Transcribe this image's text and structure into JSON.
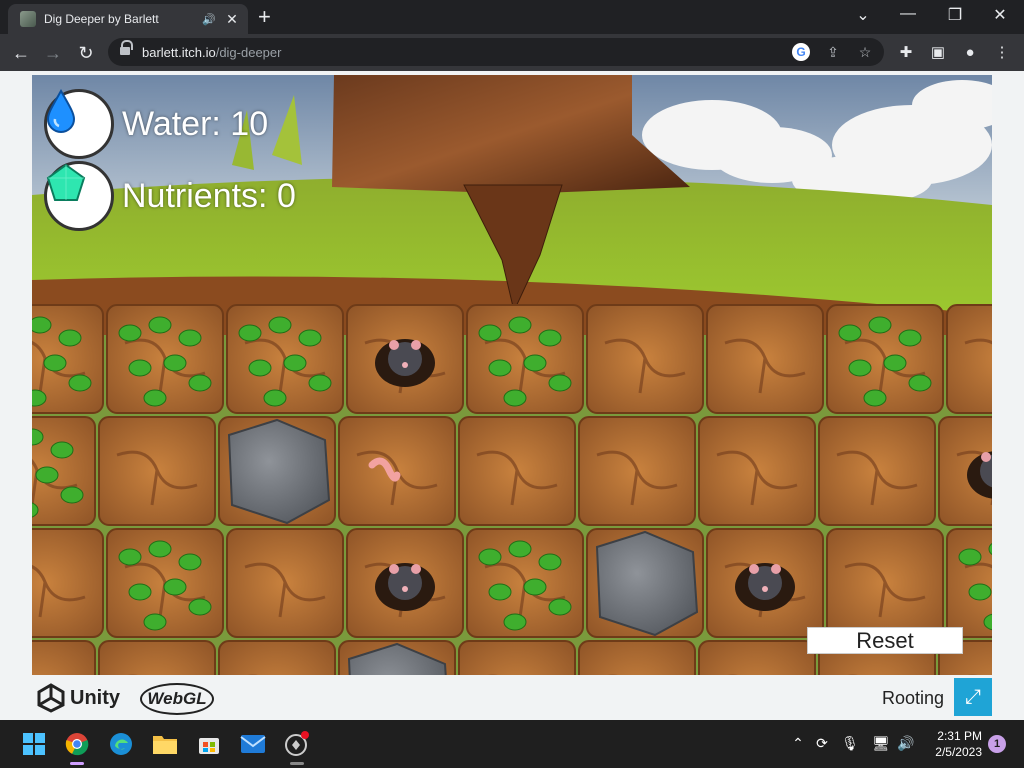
{
  "browser": {
    "tab_title": "Dig Deeper by Barlett",
    "new_tab": "+",
    "url_host": "barlett.itch.io",
    "url_path": "/dig-deeper"
  },
  "game": {
    "hud": {
      "water_label": "Water: 10",
      "nutrients_label": "Nutrients: 0",
      "water": 10,
      "nutrients": 0
    },
    "reset_label": "Reset",
    "grid": [
      [
        "leaf",
        "leaf",
        "leaf",
        "mole",
        "leaf",
        "dirt",
        "dirt",
        "leaf",
        "dirt"
      ],
      [
        "leaf",
        "dirt",
        "rock",
        "worm",
        "dirt",
        "dirt",
        "dirt",
        "dirt",
        "mole"
      ],
      [
        "dirt",
        "leaf",
        "dirt",
        "mole",
        "leaf",
        "rock",
        "mole",
        "dirt",
        "leaf"
      ],
      [
        "dirt",
        "dirt",
        "dirt",
        "rock",
        "dirt",
        "dirt",
        "dirt",
        "dirt",
        "dirt"
      ]
    ]
  },
  "footer": {
    "unity_label": "Unity",
    "webgl_label": "WebGL",
    "game_title": "Rooting"
  },
  "taskbar": {
    "time": "2:31 PM",
    "date": "2/5/2023",
    "notifications": "1"
  },
  "colors": {
    "fullscreen": "#1fa4d6",
    "water": "#1e90ff",
    "nutrient": "#2ee6b0"
  }
}
